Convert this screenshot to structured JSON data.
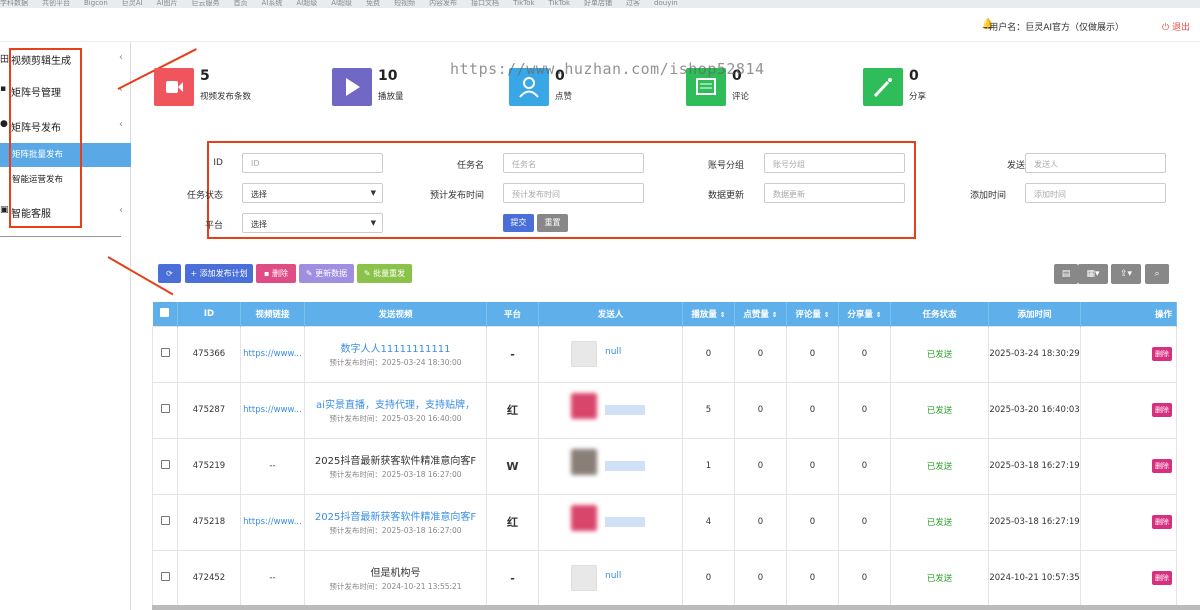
{
  "bookmarks": [
    "学科数据",
    "共创平台",
    "Bigcon",
    "巨灵AI",
    "AI图片",
    "巨云服务",
    "首页",
    "AI系统",
    "AI超级",
    "AI超级",
    "免费",
    "短视频",
    "内容发布",
    "接口文档",
    "TikTok",
    "TikTok",
    "好单店铺",
    "过客",
    "douyin"
  ],
  "topbar": {
    "user": "用户名：巨灵AI官方（仅做展示）",
    "logout": "退出",
    "bell_icon": "bell-icon",
    "logout_icon": "power-icon"
  },
  "sidebar": {
    "items": [
      {
        "label": "视频剪辑生成",
        "icon": "grid-icon"
      },
      {
        "label": "矩阵号管理",
        "icon": "list-icon"
      },
      {
        "label": "矩阵号发布",
        "icon": "send-icon"
      },
      {
        "label": "智能客服",
        "icon": "chat-icon"
      }
    ],
    "subitems": [
      {
        "label": "矩阵批量发布",
        "active": true
      },
      {
        "label": "智能运营发布",
        "active": false
      }
    ]
  },
  "watermark": "https://www.huzhan.com/ishop52814",
  "stats": [
    {
      "num": "5",
      "label": "视频发布条数",
      "color": "#f0545c",
      "icon": "video-icon"
    },
    {
      "num": "10",
      "label": "播放量",
      "color": "#7168c6",
      "icon": "play-icon"
    },
    {
      "num": "0",
      "label": "点赞",
      "color": "#39a7e6",
      "icon": "user-icon"
    },
    {
      "num": "0",
      "label": "评论",
      "color": "#2ebd59",
      "icon": "comment-icon"
    },
    {
      "num": "0",
      "label": "分享",
      "color": "#2ebd59",
      "icon": "magic-icon"
    }
  ],
  "filters": {
    "id_label": "ID",
    "id_placeholder": "ID",
    "task_label": "任务名",
    "task_placeholder": "任务名",
    "group_label": "账号分组",
    "group_placeholder": "账号分组",
    "sender_label": "发送人",
    "sender_placeholder": "发送人",
    "status_label": "任务状态",
    "status_value": "选择",
    "plan_label": "预计发布时间",
    "plan_placeholder": "预计发布时间",
    "update_label": "数据更新",
    "update_placeholder": "数据更新",
    "added_label": "添加时间",
    "added_placeholder": "添加时间",
    "platform_label": "平台",
    "platform_value": "选择",
    "submit": "提交",
    "reset": "重置"
  },
  "toolbar": {
    "refresh_icon": "refresh-icon",
    "add": "+ 添加发布计划",
    "delete": "删除",
    "update": "更新数据",
    "batch": "批量重发"
  },
  "table": {
    "headers": [
      "ID",
      "视频链接",
      "发送视频",
      "平台",
      "发送人",
      "播放量",
      "点赞量",
      "评论量",
      "分享量",
      "任务状态",
      "添加时间",
      "操作"
    ],
    "rows": [
      {
        "id": "475366",
        "link": "https://www...",
        "title": "数字人人11111111111",
        "title_blue": true,
        "time": "预计发布时间：2025-03-24 18:30:00",
        "platform": "-",
        "sender": "null",
        "avatar": "#e8e8e8",
        "play": "0",
        "like": "0",
        "comment": "0",
        "share": "0",
        "status": "已发送",
        "added": "2025-03-24 18:30:29",
        "op": "删除"
      },
      {
        "id": "475287",
        "link": "https://www...",
        "title": "ai实景直播，支持代理，支持贴牌，",
        "title_blue": true,
        "time": "预计发布时间：2025-03-20 16:40:00",
        "platform": "红",
        "sender": "",
        "avatar": "#d9466b",
        "play": "5",
        "like": "0",
        "comment": "0",
        "share": "0",
        "status": "已发送",
        "added": "2025-03-20 16:40:03",
        "op": "删除"
      },
      {
        "id": "475219",
        "link": "--",
        "title": "2025抖音最新获客软件精准意向客F",
        "title_blue": false,
        "time": "预计发布时间：2025-03-18 16:27:00",
        "platform": "W",
        "sender": "",
        "avatar": "#8a7f78",
        "play": "1",
        "like": "0",
        "comment": "0",
        "share": "0",
        "status": "已发送",
        "added": "2025-03-18 16:27:19",
        "op": "删除"
      },
      {
        "id": "475218",
        "link": "https://www...",
        "title": "2025抖音最新获客软件精准意向客F",
        "title_blue": true,
        "time": "预计发布时间：2025-03-18 16:27:00",
        "platform": "红",
        "sender": "",
        "avatar": "#d9466b",
        "play": "4",
        "like": "0",
        "comment": "0",
        "share": "0",
        "status": "已发送",
        "added": "2025-03-18 16:27:19",
        "op": "删除"
      },
      {
        "id": "472452",
        "link": "--",
        "title": "但是机构号",
        "title_blue": false,
        "time": "预计发布时间：2024-10-21 13:55:21",
        "platform": "-",
        "sender": "null",
        "avatar": "#e8e8e8",
        "play": "0",
        "like": "0",
        "comment": "0",
        "share": "0",
        "status": "已发送",
        "added": "2024-10-21 10:57:35",
        "op": "删除"
      }
    ]
  }
}
